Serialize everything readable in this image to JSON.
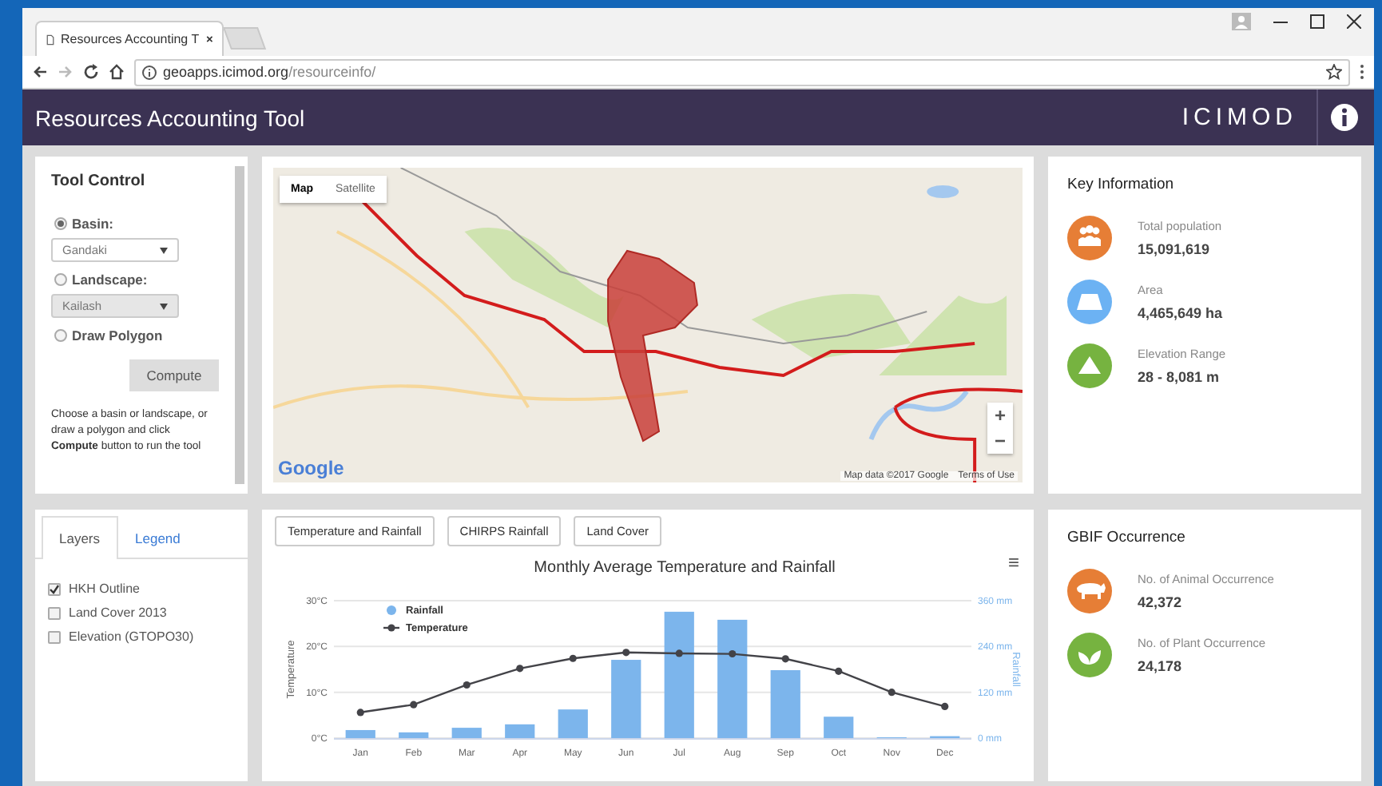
{
  "browser": {
    "tab_title": "Resources Accounting T",
    "url_host": "geoapps.icimod.org",
    "url_path": "/resourceinfo/"
  },
  "header": {
    "title": "Resources Accounting Tool",
    "logo": "ICIMOD"
  },
  "tool_control": {
    "title": "Tool Control",
    "options": [
      {
        "label": "Basin:",
        "selected": true,
        "select": {
          "value": "Gandaki",
          "disabled": false
        }
      },
      {
        "label": "Landscape:",
        "selected": false,
        "select": {
          "value": "Kailash",
          "disabled": true
        }
      },
      {
        "label": "Draw Polygon",
        "selected": false
      }
    ],
    "button": "Compute",
    "help": "Choose a basin or landscape, or draw a polygon and click **Compute** button to run the tool"
  },
  "map": {
    "type_buttons": [
      {
        "label": "Map",
        "selected": true
      },
      {
        "label": "Satellite",
        "selected": false
      }
    ],
    "zoom_in": "+",
    "zoom_out": "−",
    "logo": "Google",
    "attribution": "Map data ©2017 Google",
    "terms": "Terms of Use"
  },
  "key_information": {
    "title": "Key Information",
    "items": [
      {
        "kind": "people",
        "color": "#e67e36",
        "label": "Total population",
        "value": "15,091,619"
      },
      {
        "kind": "area",
        "color": "#6cb2f3",
        "label": "Area",
        "value": "4,465,649 ha"
      },
      {
        "kind": "mountain",
        "color": "#76b340",
        "label": "Elevation Range",
        "value": "28 - 8,081 m"
      }
    ]
  },
  "layers": {
    "tabs": [
      {
        "label": "Layers",
        "selected": true
      },
      {
        "label": "Legend",
        "selected": false
      }
    ],
    "items": [
      {
        "label": "HKH Outline",
        "checked": true
      },
      {
        "label": "Land Cover 2013",
        "checked": false
      },
      {
        "label": "Elevation (GTOPO30)",
        "checked": false
      }
    ]
  },
  "chart_panel": {
    "buttons": [
      "Temperature and Rainfall",
      "CHIRPS Rainfall",
      "Land Cover"
    ],
    "menu": "≡",
    "chart_data": {
      "type": "bar",
      "title": "Monthly Average Temperature and Rainfall",
      "legend": true,
      "ylabel": "Temperature",
      "y2label": "Rainfall",
      "categories": [
        "Jan",
        "Feb",
        "Mar",
        "Apr",
        "May",
        "Jun",
        "Jul",
        "Aug",
        "Sep",
        "Oct",
        "Nov",
        "Dec"
      ],
      "ylim": [
        0,
        30
      ],
      "yticks": [
        {
          "value": 0,
          "label": "0°C"
        },
        {
          "value": 10,
          "label": "10°C"
        },
        {
          "value": 20,
          "label": "20°C"
        },
        {
          "value": 30,
          "label": "30°C"
        }
      ],
      "y2lim": [
        0,
        360
      ],
      "y2ticks": [
        {
          "value": 0,
          "label": "0 mm"
        },
        {
          "value": 120,
          "label": "120 mm"
        },
        {
          "value": 240,
          "label": "240 mm"
        },
        {
          "value": 360,
          "label": "360 mm"
        }
      ],
      "series": [
        {
          "name": "Rainfall",
          "type": "bar",
          "axis": "y2",
          "color": "#7cb5ec",
          "values": [
            21,
            15,
            27,
            36,
            75,
            205,
            331,
            310,
            178,
            56,
            2,
            5
          ]
        },
        {
          "name": "Temperature",
          "type": "line",
          "marker": "circle",
          "color": "#434348",
          "values": [
            5.6,
            7.3,
            11.6,
            15.2,
            17.4,
            18.7,
            18.5,
            18.4,
            17.3,
            14.6,
            10,
            6.9
          ]
        }
      ]
    }
  },
  "gbif": {
    "title": "GBIF Occurrence",
    "items": [
      {
        "kind": "animal",
        "color": "#e67e36",
        "label": "No. of Animal Occurrence",
        "value": "42,372"
      },
      {
        "kind": "leaf",
        "color": "#76b340",
        "label": "No. of Plant Occurrence",
        "value": "24,178"
      }
    ]
  }
}
